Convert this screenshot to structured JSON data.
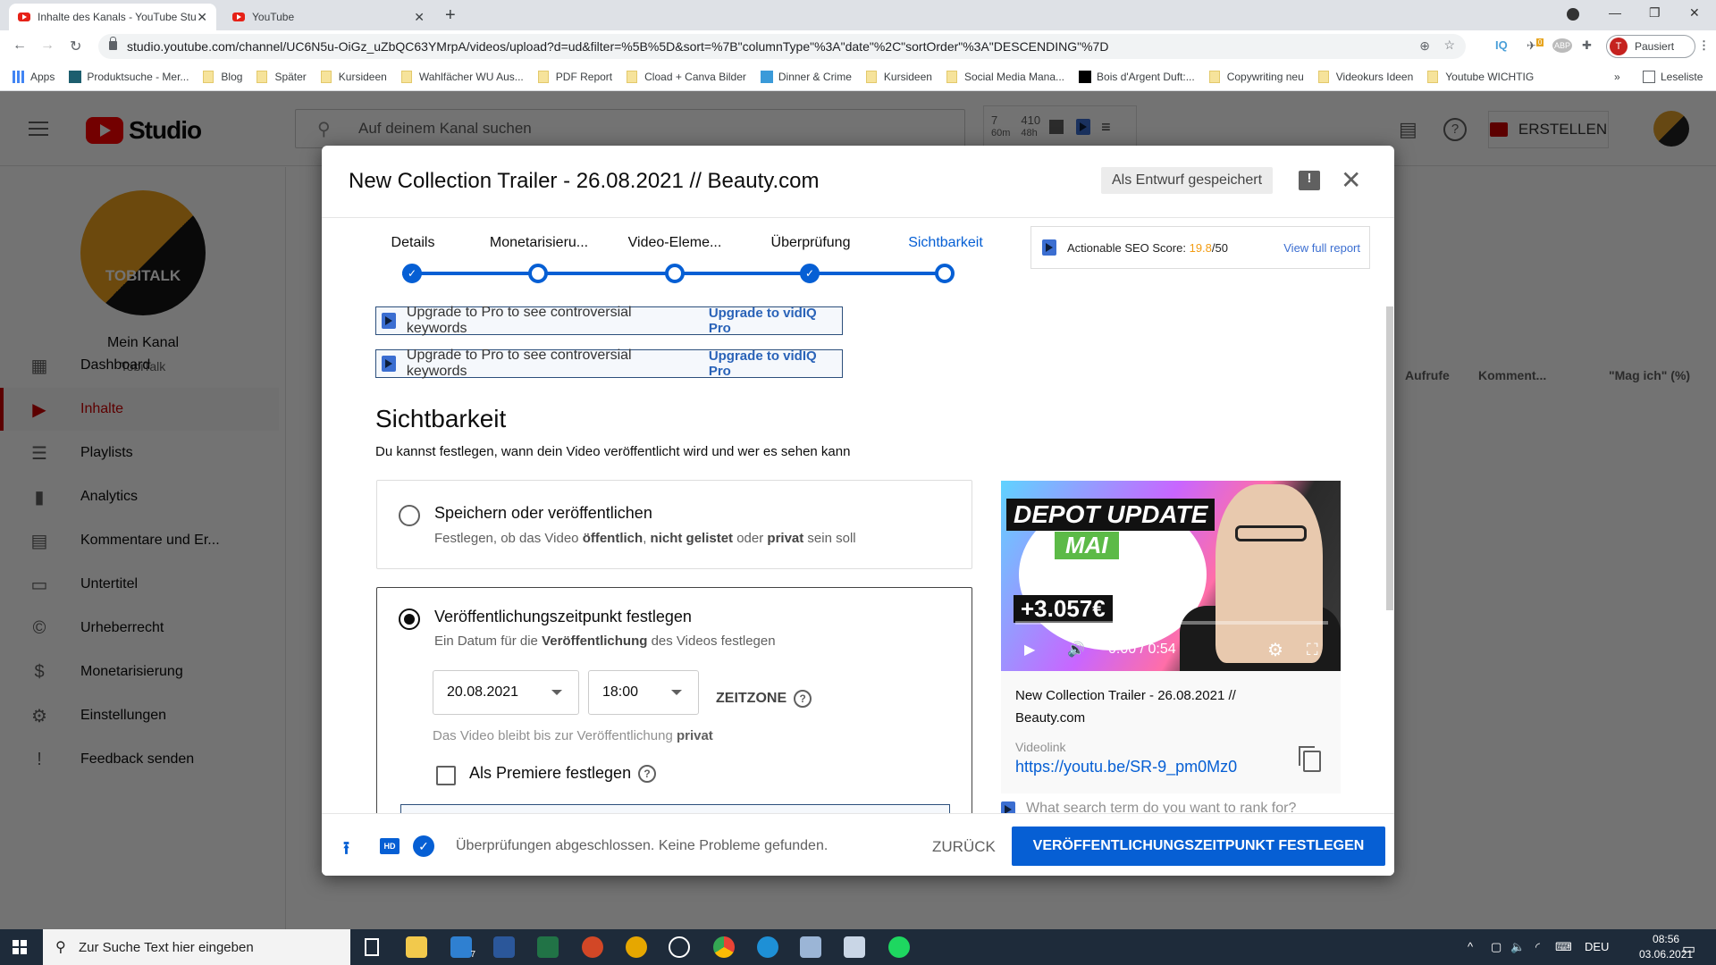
{
  "browser": {
    "tabs": [
      {
        "title": "Inhalte des Kanals - YouTube Stu",
        "active": true
      },
      {
        "title": "YouTube",
        "active": false
      }
    ],
    "url": "studio.youtube.com/channel/UC6N5u-OiGz_uZbQC63YMrpA/videos/upload?d=ud&filter=%5B%5D&sort=%7B\"columnType\"%3A\"date\"%2C\"sortOrder\"%3A\"DESCENDING\"%7D",
    "profile_initial": "T",
    "profile_label": "Pausiert",
    "extensions": [
      "IQ",
      "0",
      "ABP"
    ],
    "bookmarks": [
      "Apps",
      "Produktsuche - Mer...",
      "Blog",
      "Später",
      "Kursideen",
      "Wahlfächer WU Aus...",
      "PDF Report",
      "Cload + Canva Bilder",
      "Dinner & Crime",
      "Kursideen",
      "Social Media Mana...",
      "Bois d'Argent Duft:...",
      "Copywriting neu",
      "Videokurs Ideen",
      "Youtube WICHTIG"
    ],
    "bookmarks_overflow": "»",
    "reading_list": "Leseliste"
  },
  "studio": {
    "logo": "Studio",
    "search_placeholder": "Auf deinem Kanal suchen",
    "vidiq_stats": {
      "a_value": "7",
      "a_label": "60m",
      "b_value": "410",
      "b_label": "48h"
    },
    "create_label": "ERSTELLEN",
    "channel": {
      "title": "Mein Kanal",
      "name": "TobiTalk",
      "avatar_text": "TOBITALK"
    },
    "nav": [
      {
        "label": "Dashboard",
        "icon": "dashboard-icon",
        "glyph": "▦"
      },
      {
        "label": "Inhalte",
        "icon": "content-icon",
        "glyph": "▶",
        "active": true
      },
      {
        "label": "Playlists",
        "icon": "playlist-icon",
        "glyph": "☰"
      },
      {
        "label": "Analytics",
        "icon": "analytics-icon",
        "glyph": "▮"
      },
      {
        "label": "Kommentare und Er...",
        "icon": "comments-icon",
        "glyph": "▤"
      },
      {
        "label": "Untertitel",
        "icon": "subtitles-icon",
        "glyph": "▭"
      },
      {
        "label": "Urheberrecht",
        "icon": "copyright-icon",
        "glyph": "©"
      },
      {
        "label": "Monetarisierung",
        "icon": "dollar-icon",
        "glyph": "$"
      },
      {
        "label": "Einstellungen",
        "icon": "gear-icon",
        "glyph": "⚙"
      },
      {
        "label": "Feedback senden",
        "icon": "feedback-icon",
        "glyph": "!"
      }
    ],
    "table_columns": [
      "Aufrufe",
      "Komment...",
      "\"Mag ich\" (%)"
    ]
  },
  "modal": {
    "title": "New Collection Trailer - 26.08.2021 // Beauty.com",
    "draft_status": "Als Entwurf gespeichert",
    "steps": [
      {
        "label": "Details",
        "state": "done"
      },
      {
        "label": "Monetarisieru...",
        "state": "open"
      },
      {
        "label": "Video-Eleme...",
        "state": "open"
      },
      {
        "label": "Überprüfung",
        "state": "done"
      },
      {
        "label": "Sichtbarkeit",
        "state": "current"
      }
    ],
    "seo": {
      "label": "Actionable SEO Score: ",
      "score": "19.8",
      "max": "/50",
      "link": "View full report"
    },
    "upgrade_banners": [
      {
        "text": "Upgrade to Pro to see controversial keywords",
        "link": "Upgrade to vidIQ Pro"
      },
      {
        "text": "Upgrade to Pro to see controversial keywords",
        "link": "Upgrade to vidIQ Pro"
      }
    ],
    "visibility": {
      "heading": "Sichtbarkeit",
      "subheading": "Du kannst festlegen, wann dein Video veröffentlicht wird und wer es sehen kann",
      "option_save": {
        "title": "Speichern oder veröffentlichen",
        "desc_parts": [
          "Festlegen, ob das Video ",
          "öffentlich",
          ", ",
          "nicht gelistet",
          " oder ",
          "privat",
          " sein soll"
        ],
        "selected": false
      },
      "option_schedule": {
        "title": "Veröffentlichungszeitpunkt festlegen",
        "desc_parts": [
          "Ein Datum für die ",
          "Veröffentlichung",
          " des Videos festlegen"
        ],
        "selected": true,
        "date": "20.08.2021",
        "time": "18:00",
        "timezone_label": "ZEITZONE",
        "private_note": "Das Video bleibt bis zur Veröffentlichung ",
        "private_bold": "privat",
        "premiere_label": "Als Premiere festlegen",
        "premiere_checked": false
      }
    },
    "preview": {
      "thumb_line1": "DEPOT UPDATE",
      "thumb_line2": "MAI",
      "thumb_line3": "+3.057€",
      "time": "0:00 / 0:54",
      "progress": 0,
      "video_title": "New Collection Trailer - 26.08.2021 // Beauty.com",
      "link_label": "Videolink",
      "link": "https://youtu.be/SR-9_pm0Mz0"
    },
    "rank_placeholder": "What search term do you want to rank for?",
    "footer": {
      "status": "Überprüfungen abgeschlossen. Keine Probleme gefunden.",
      "hd": "HD",
      "back": "ZURÜCK",
      "primary": "VERÖFFENTLICHUNGSZEITPUNKT FESTLEGEN"
    }
  },
  "taskbar": {
    "search_placeholder": "Zur Suche Text hier eingeben",
    "mail_badge": "7",
    "lang": "DEU",
    "time": "08:56",
    "date": "03.06.2021"
  }
}
